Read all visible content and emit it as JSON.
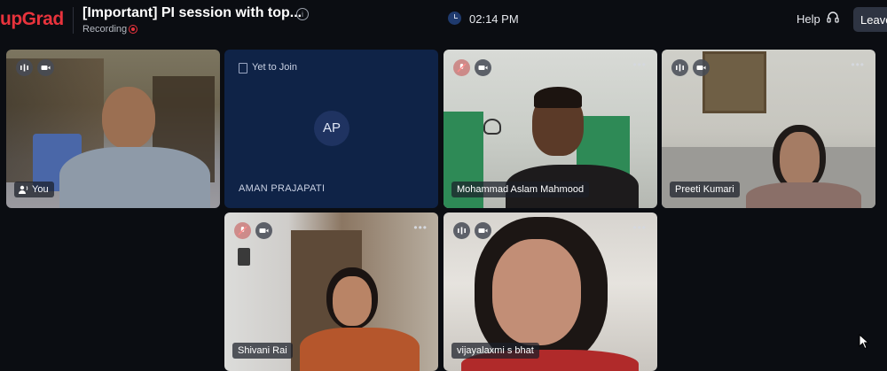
{
  "header": {
    "logo": "upGrad",
    "title": "[Important] PI session with top...",
    "recording_label": "Recording",
    "time": "02:14 PM",
    "help_label": "Help",
    "leave_label": "Leave"
  },
  "participants": [
    {
      "name": "You",
      "mic": "active",
      "camera": "on"
    },
    {
      "name": "AMAN PRAJAPATI",
      "initials": "AP",
      "status": "Yet to Join"
    },
    {
      "name": "Mohammad Aslam Mahmood",
      "mic": "muted",
      "camera": "on"
    },
    {
      "name": "Preeti Kumari",
      "mic": "active",
      "camera": "on"
    },
    {
      "name": "Shivani Rai",
      "mic": "muted",
      "camera": "on"
    },
    {
      "name": "vijayalaxmi s bhat",
      "mic": "active",
      "camera": "on"
    }
  ],
  "colors": {
    "brand": "#e8333c",
    "background": "#0b0d12",
    "waiting_tile": "#0f2347",
    "avatar": "#1f3361"
  }
}
